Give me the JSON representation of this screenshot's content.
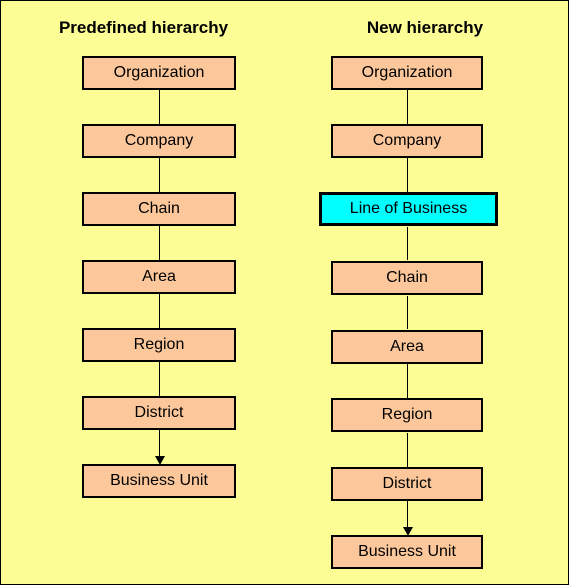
{
  "diagram": {
    "title_left": "Predefined hierarchy",
    "title_right": "New hierarchy",
    "background_color": "#FDFD96",
    "node_fill_color": "#FCC89B",
    "highlight_fill_color": "#00FFFF",
    "border_color": "#000000"
  },
  "predefined_hierarchy": {
    "title": "Predefined hierarchy",
    "levels": [
      {
        "label": "Organization",
        "highlight": false
      },
      {
        "label": "Company",
        "highlight": false
      },
      {
        "label": "Chain",
        "highlight": false
      },
      {
        "label": "Area",
        "highlight": false
      },
      {
        "label": "Region",
        "highlight": false
      },
      {
        "label": "District",
        "highlight": false
      },
      {
        "label": "Business Unit",
        "highlight": false
      }
    ]
  },
  "new_hierarchy": {
    "title": "New hierarchy",
    "levels": [
      {
        "label": "Organization",
        "highlight": false
      },
      {
        "label": "Company",
        "highlight": false
      },
      {
        "label": "Line of Business",
        "highlight": true
      },
      {
        "label": "Chain",
        "highlight": false
      },
      {
        "label": "Area",
        "highlight": false
      },
      {
        "label": "Region",
        "highlight": false
      },
      {
        "label": "District",
        "highlight": false
      },
      {
        "label": "Business Unit",
        "highlight": false
      }
    ]
  }
}
